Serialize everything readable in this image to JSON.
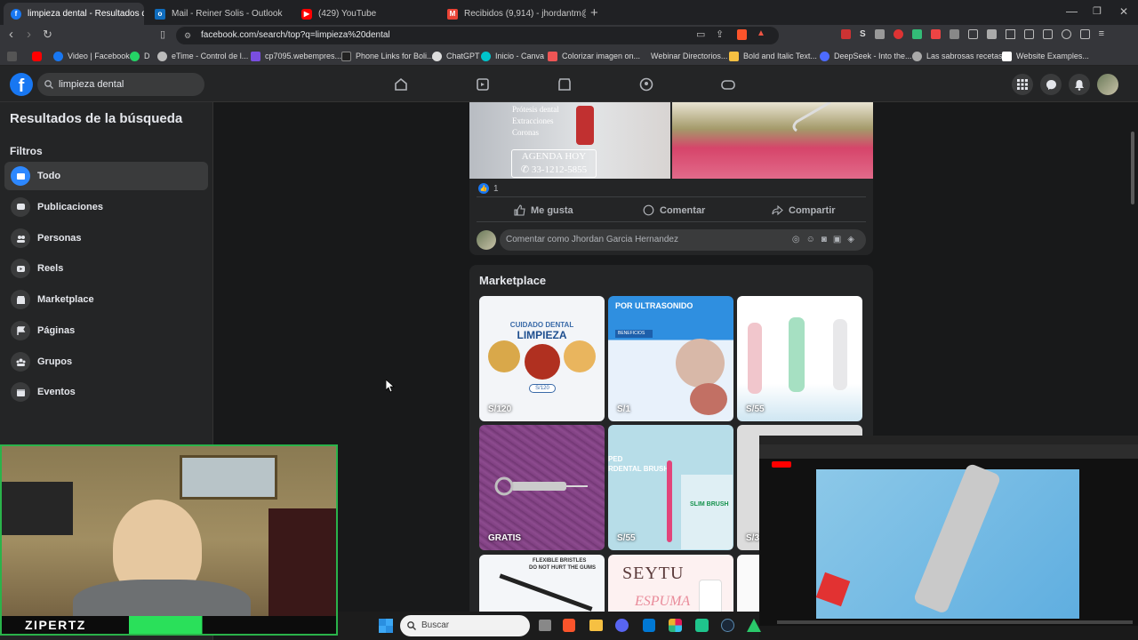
{
  "browser": {
    "tabs": [
      {
        "title": "limpieza dental - Resultados de",
        "active": true
      },
      {
        "title": "Mail - Reiner Solis - Outlook"
      },
      {
        "title": "(429) YouTube"
      },
      {
        "title": "Recibidos (9,914) - jhordantm@gmai"
      }
    ],
    "url": "facebook.com/search/top?q=limpieza%20dental",
    "bookmarks": [
      "D",
      "Video | Facebook",
      "eTime - Control de l...",
      "cp7095.webempres...",
      "Phone Links for Boli...",
      "ChatGPT",
      "Inicio - Canva",
      "Colorizar imagen on...",
      "Webinar Directorios...",
      "Bold and Italic Text...",
      "DeepSeek - Into the...",
      "Las sabrosas recetas...",
      "Website Examples..."
    ],
    "colors": {
      "accent": "#1877f2"
    }
  },
  "fb": {
    "search_value": "limpieza dental",
    "sidebar": {
      "title": "Resultados de la búsqueda",
      "filters_label": "Filtros",
      "items": [
        "Todo",
        "Publicaciones",
        "Personas",
        "Reels",
        "Marketplace",
        "Páginas",
        "Grupos",
        "Eventos"
      ]
    },
    "post": {
      "ad_lines": [
        "Prótesis dental",
        "Extracciones",
        "Coronas"
      ],
      "ad_cta": "AGENDA HOY",
      "ad_phone": "33-1212-5855",
      "reaction_count": "1",
      "like": "Me gusta",
      "comment": "Comentar",
      "share": "Compartir",
      "comment_placeholder": "Comentar como Jhordan Garcia Hernandez"
    },
    "marketplace": {
      "title": "Marketplace",
      "tiles": [
        {
          "price": "S/120",
          "text1": "CUIDADO DENTAL",
          "text2": "LIMPIEZA",
          "badge": "S/120"
        },
        {
          "price": "S/1",
          "text1": "POR ULTRASONIDO",
          "text2": "BENEFICIOS"
        },
        {
          "price": "S/55"
        },
        {
          "price": "GRATIS"
        },
        {
          "price": "S/55",
          "text1": "PED",
          "text2": "RDENTAL BRUSH",
          "text3": "SLIM BRUSH"
        },
        {
          "price": "S/3"
        },
        {
          "text1": "FLEXIBLE BRISTLES",
          "text2": "DO NOT HURT THE GUMS"
        },
        {
          "text1": "SEYTU",
          "text2": "ESPUMA"
        }
      ]
    }
  },
  "overlay": {
    "streamer_name": "ZIPERTZ",
    "taskbar_search": "Buscar"
  }
}
